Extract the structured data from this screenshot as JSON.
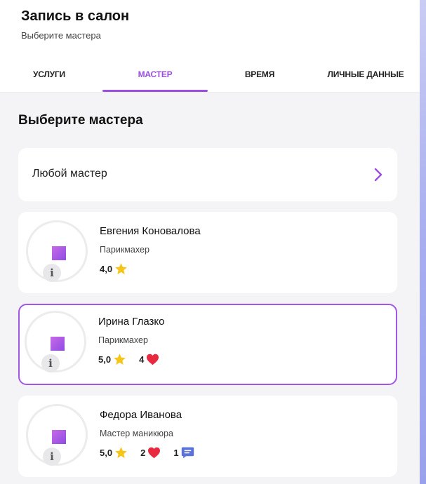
{
  "header": {
    "title": "Запись в салон",
    "subtitle": "Выберите мастера"
  },
  "tabs": [
    {
      "label": "УСЛУГИ",
      "active": false
    },
    {
      "label": "МАСТЕР",
      "active": true
    },
    {
      "label": "ВРЕМЯ",
      "active": false
    },
    {
      "label": "ЛИЧНЫЕ ДАННЫЕ",
      "active": false
    }
  ],
  "main": {
    "section_title": "Выберите мастера",
    "any_master_label": "Любой мастер"
  },
  "masters": [
    {
      "name": "Евгения Коновалова",
      "role": "Парикмахер",
      "rating": "4,0",
      "likes": null,
      "reviews": null,
      "selected": false,
      "info": "i"
    },
    {
      "name": "Ирина Глазко",
      "role": "Парикмахер",
      "rating": "5,0",
      "likes": "4",
      "reviews": null,
      "selected": true,
      "info": "i"
    },
    {
      "name": "Федора Иванова",
      "role": "Мастер маникюра",
      "rating": "5,0",
      "likes": "2",
      "reviews": "1",
      "selected": false,
      "info": "i"
    }
  ],
  "colors": {
    "accent": "#9b4fe0",
    "star": "#f5c518",
    "heart": "#e8293f",
    "comment": "#5b73d9"
  },
  "icons": [
    "chevron-right-icon",
    "star-icon",
    "heart-icon",
    "comment-icon",
    "info-icon",
    "avatar-placeholder-icon"
  ]
}
